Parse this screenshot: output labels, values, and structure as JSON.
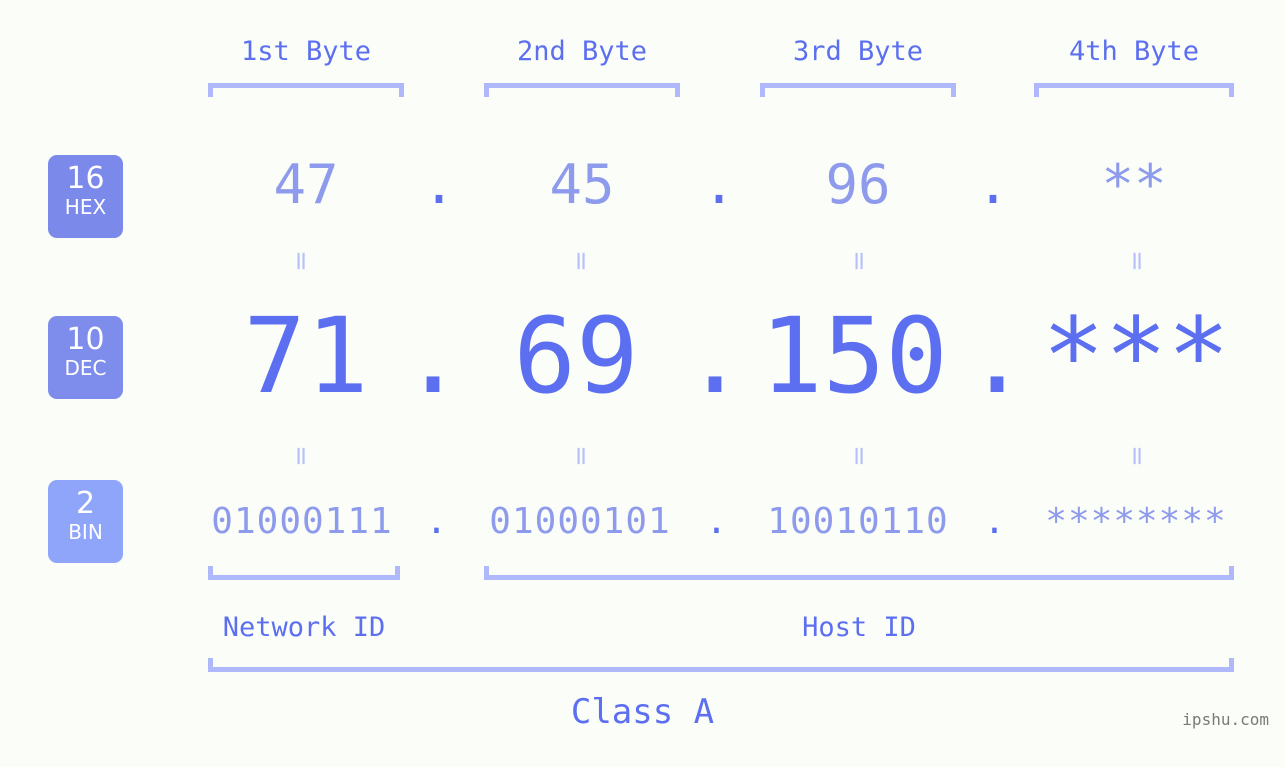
{
  "background": "#fbfdf8",
  "accent_strong": "#5c6ff0",
  "accent_light": "#8e9aec",
  "bracket_color": "#aeb8fb",
  "byte_headers": [
    {
      "label": "1st Byte"
    },
    {
      "label": "2nd Byte"
    },
    {
      "label": "3rd Byte"
    },
    {
      "label": "4th Byte"
    }
  ],
  "systems": [
    {
      "base": "16",
      "name": "HEX",
      "color": "#7b89ea"
    },
    {
      "base": "10",
      "name": "DEC",
      "color": "#7e8cec"
    },
    {
      "base": "2",
      "name": "BIN",
      "color": "#8ea5fa"
    }
  ],
  "rows": {
    "hex": {
      "b1": "47",
      "b2": "45",
      "b3": "96",
      "b4": "**",
      "sep": "."
    },
    "dec": {
      "b1": "71",
      "b2": "69",
      "b3": "150",
      "b4": "***",
      "sep": "."
    },
    "bin": {
      "b1": "01000111",
      "b2": "01000101",
      "b3": "10010110",
      "b4": "********",
      "sep": "."
    }
  },
  "equality_marks": {
    "hex_to_dec": [
      "=",
      "=",
      "=",
      "="
    ],
    "dec_to_bin": [
      "=",
      "=",
      "=",
      "="
    ],
    "glyph": "="
  },
  "id_labels": {
    "network": "Network ID",
    "host": "Host ID"
  },
  "class_label": "Class A",
  "watermark": "ipshu.com"
}
